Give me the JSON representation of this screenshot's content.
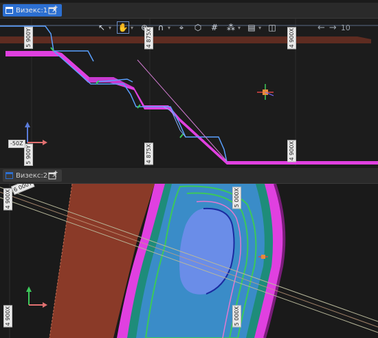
{
  "viewports": [
    {
      "tab_label": "Визекс:1",
      "active": true
    },
    {
      "tab_label": "Визекс:2",
      "active": false
    }
  ],
  "toolbar": {
    "undo_icon": "undo-arrow-icon",
    "redo_icon": "redo-arrow-icon",
    "step_value": "10"
  },
  "view1": {
    "labels": {
      "y_top": "5 900Y",
      "y_bottom": "5 900Y",
      "x_mid_top": "4 875X",
      "x_mid_bottom": "4 875X",
      "x_right_top": "4 900X",
      "x_right_bottom": "4 900X",
      "z_left": "-50Z"
    }
  },
  "view2": {
    "labels": {
      "x_left_top": "4 900X",
      "y_left_top": "6 000Y",
      "x_left_bottom": "4 900X",
      "x_center_top": "5 000X",
      "x_center_bottom": "5 000X"
    }
  },
  "colors": {
    "accent": "#2c6fd1",
    "magenta": "#e040e0",
    "profile_blue": "#5aa0ff",
    "bg": "#1b1b1b"
  }
}
